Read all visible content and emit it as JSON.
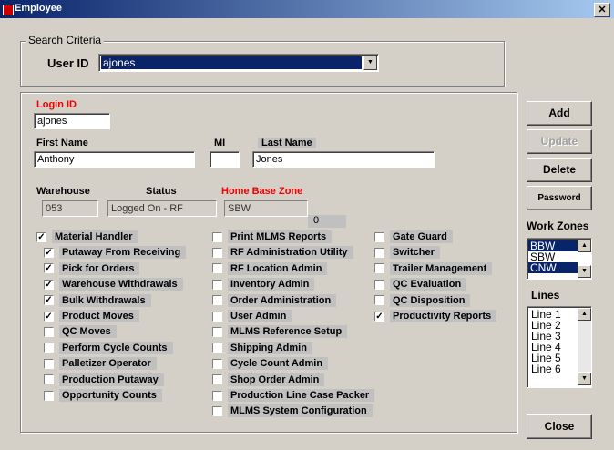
{
  "window": {
    "title": "Employee",
    "close_glyph": "✕"
  },
  "search": {
    "group_label": "Search Criteria",
    "user_id_label": "User ID",
    "user_id_value": "ajones"
  },
  "login": {
    "label": "Login ID",
    "value": "ajones"
  },
  "first_name": {
    "label": "First Name",
    "value": "Anthony"
  },
  "mi": {
    "label": "MI",
    "value": ""
  },
  "last_name": {
    "label": "Last Name",
    "value": "Jones"
  },
  "warehouse": {
    "label": "Warehouse",
    "value": "053"
  },
  "status": {
    "label": "Status",
    "value": "Logged On - RF"
  },
  "home_base": {
    "label": "Home Base Zone",
    "value": "SBW"
  },
  "counter": "0",
  "permissions_col1": [
    {
      "label": "Material Handler",
      "checked": true
    },
    {
      "label": "Putaway From Receiving",
      "checked": true
    },
    {
      "label": "Pick for Orders",
      "checked": true
    },
    {
      "label": "Warehouse Withdrawals",
      "checked": true
    },
    {
      "label": "Bulk Withdrawals",
      "checked": true
    },
    {
      "label": "Product Moves",
      "checked": true
    },
    {
      "label": "QC Moves",
      "checked": false
    },
    {
      "label": "Perform Cycle Counts",
      "checked": false
    },
    {
      "label": "Palletizer Operator",
      "checked": false
    },
    {
      "label": "Production Putaway",
      "checked": false
    },
    {
      "label": "Opportunity Counts",
      "checked": false
    }
  ],
  "permissions_col2": [
    {
      "label": "Print MLMS Reports",
      "checked": false
    },
    {
      "label": "RF Administration Utility",
      "checked": false
    },
    {
      "label": "RF Location Admin",
      "checked": false
    },
    {
      "label": "Inventory Admin",
      "checked": false
    },
    {
      "label": "Order Administration",
      "checked": false
    },
    {
      "label": "User Admin",
      "checked": false
    },
    {
      "label": "MLMS Reference Setup",
      "checked": false
    },
    {
      "label": "Shipping Admin",
      "checked": false
    },
    {
      "label": "Cycle Count Admin",
      "checked": false
    },
    {
      "label": "Shop Order Admin",
      "checked": false
    },
    {
      "label": "Production Line Case Packer",
      "checked": false
    },
    {
      "label": "MLMS System Configuration",
      "checked": false
    }
  ],
  "permissions_col3": [
    {
      "label": "Gate Guard",
      "checked": false
    },
    {
      "label": "Switcher",
      "checked": false
    },
    {
      "label": "Trailer Management",
      "checked": false
    },
    {
      "label": "QC Evaluation",
      "checked": false
    },
    {
      "label": "QC Disposition",
      "checked": false
    },
    {
      "label": "Productivity Reports",
      "checked": true
    }
  ],
  "buttons": {
    "add": "Add",
    "update": "Update",
    "delete": "Delete",
    "password": "Password",
    "close": "Close"
  },
  "work_zones": {
    "label": "Work Zones",
    "items": [
      "BBW",
      "SBW",
      "CNW"
    ]
  },
  "lines": {
    "label": "Lines",
    "items": [
      "Line 1",
      "Line 2",
      "Line 3",
      "Line 4",
      "Line 5",
      "Line 6"
    ]
  },
  "colors": {
    "title_start": "#0a246a",
    "title_end": "#a6caf0",
    "required_label": "#e00000",
    "selection": "#0a246a"
  }
}
